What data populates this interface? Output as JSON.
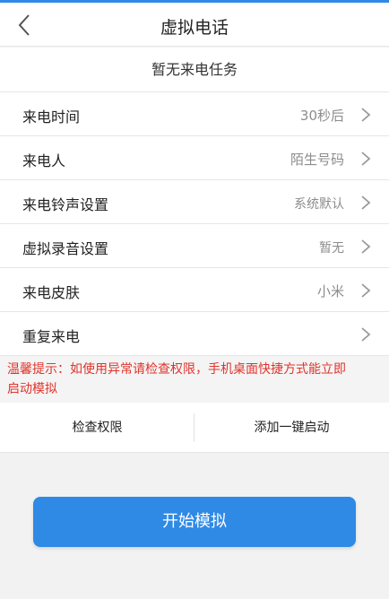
{
  "colors": {
    "accent": "#2f8ae6",
    "tip_text": "#e0342c",
    "secondary_text": "#8c8c8c"
  },
  "header": {
    "back_icon": "chevron-left-icon",
    "title": "虚拟电话"
  },
  "status_text": "暂无来电任务",
  "settings": [
    {
      "label": "来电时间",
      "value": "30秒后"
    },
    {
      "label": "来电人",
      "value": "陌生号码"
    },
    {
      "label": "来电铃声设置",
      "value": "系统默认"
    },
    {
      "label": "虚拟录音设置",
      "value": "暂无"
    },
    {
      "label": "来电皮肤",
      "value": "小米"
    },
    {
      "label": "重复来电",
      "value": ""
    }
  ],
  "tip": {
    "line1": "温馨提示：如使用异常请检查权限，手机桌面快捷方式能立即",
    "line2": "启动模拟"
  },
  "actions": {
    "check_permission": "检查权限",
    "add_shortcut": "添加一键启动"
  },
  "start_button": "开始模拟"
}
